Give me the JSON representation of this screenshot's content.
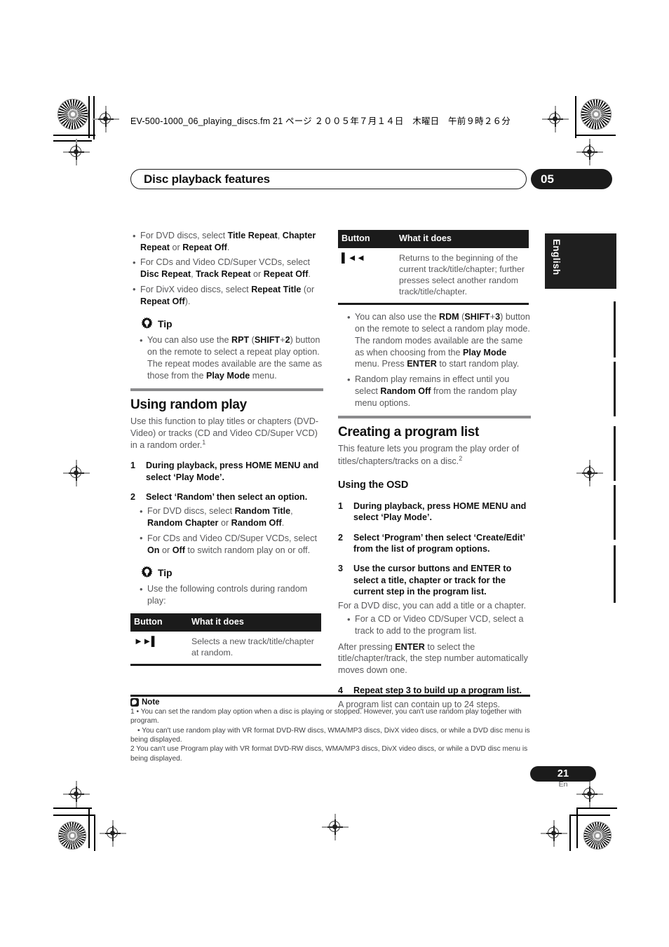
{
  "print_marks": {
    "file_slug": "EV-500-1000_06_playing_discs.fm  21 ページ  ２００５年７月１４日　木曜日　午前９時２６分"
  },
  "running_head": {
    "title": "Disc playback features",
    "chapter_number": "05"
  },
  "language_tab": {
    "label": "English"
  },
  "left_column": {
    "repeat_bullets": [
      "For DVD discs, select <b>Title Repeat</b>, <b>Chapter Repeat</b> or <b>Repeat Off</b>.",
      "For CDs and Video CD/Super VCDs, select <b>Disc Repeat</b>, <b>Track Repeat</b> or <b>Repeat Off</b>.",
      "For DivX video discs, select <b>Repeat Title</b> (or <b>Repeat Off</b>)."
    ],
    "tip1": {
      "label": "Tip",
      "bullets": [
        "You can also use the <b>RPT</b> (<b>SHIFT</b>+<b>2</b>) button on the remote to select a repeat play option. The repeat modes available are the same as those from the <b>Play Mode</b> menu."
      ]
    },
    "random_section": {
      "heading": "Using random play",
      "intro": "Use this function to play titles or chapters (DVD-Video) or tracks (CD and Video CD/Super VCD) in a random order.<sup>1</sup>",
      "steps": [
        {
          "num": "1",
          "text": "During playback, press HOME MENU and select ‘Play Mode’.",
          "bullets": []
        },
        {
          "num": "2",
          "text": "Select ‘Random’ then select an option.",
          "bullets": [
            "For DVD discs, select <b>Random Title</b>, <b>Random Chapter</b> or <b>Random Off</b>.",
            "For CDs and Video CD/Super VCDs, select <b>On</b> or <b>Off</b> to switch random play on or off."
          ]
        }
      ]
    },
    "tip2": {
      "label": "Tip",
      "bullets": [
        "Use the following controls during random play:"
      ]
    },
    "button_table": {
      "headers": [
        "Button",
        "What it does"
      ],
      "rows": [
        {
          "button": "►►▌",
          "button_name": "next-track-button",
          "description": "Selects a new track/title/chapter at random."
        }
      ]
    }
  },
  "right_column": {
    "button_table": {
      "headers": [
        "Button",
        "What it does"
      ],
      "rows": [
        {
          "button": "▌◄◄",
          "button_name": "previous-track-button",
          "description": "Returns to the beginning of the current track/title/chapter; further presses select another random track/title/chapter."
        }
      ]
    },
    "random_bullets": [
      "You can also use the <b>RDM</b> (<b>SHIFT</b>+<b>3</b>) button on the remote to select a random play mode. The random modes available are the same as when choosing from the <b>Play Mode</b> menu. Press <b>ENTER</b> to start random play.",
      "Random play remains in effect until you select <b>Random Off</b> from the random play menu options."
    ],
    "program_section": {
      "heading": "Creating a program list",
      "intro": "This feature lets you program the play order of titles/chapters/tracks on a disc.<sup>2</sup>",
      "subheading": "Using the OSD",
      "steps": [
        {
          "num": "1",
          "text": "During playback, press HOME MENU and select ‘Play Mode’.",
          "after": "",
          "bullets": []
        },
        {
          "num": "2",
          "text": "Select ‘Program’ then select ‘Create/Edit’ from the list of program options.",
          "after": "",
          "bullets": []
        },
        {
          "num": "3",
          "text": "Use the cursor buttons and ENTER to select a title, chapter or track for the current step in the program list.",
          "after": "For a DVD disc, you can add a title or a chapter.",
          "bullets": [
            "For a CD or Video CD/Super VCD, select a track to add to the program list."
          ],
          "after2": "After pressing <b>ENTER</b> to select the title/chapter/track, the step number automatically moves down one."
        },
        {
          "num": "4",
          "text": "Repeat step 3 to build up a program list.",
          "after": "A program list can contain up to 24 steps.",
          "bullets": []
        }
      ]
    }
  },
  "note_block": {
    "label": "Note",
    "lines": [
      "1 • You can set the random play option when a disc is playing or stopped. However, you can't use random play together with program.",
      "• You can't use random play with VR format DVD-RW discs, WMA/MP3 discs, DivX video discs, or while a DVD disc menu is being displayed.",
      "2 You can't use Program play with VR format DVD-RW discs, WMA/MP3 discs, DivX video discs, or while a DVD disc menu is being displayed."
    ]
  },
  "folio": {
    "page_number": "21",
    "language_code": "En"
  }
}
